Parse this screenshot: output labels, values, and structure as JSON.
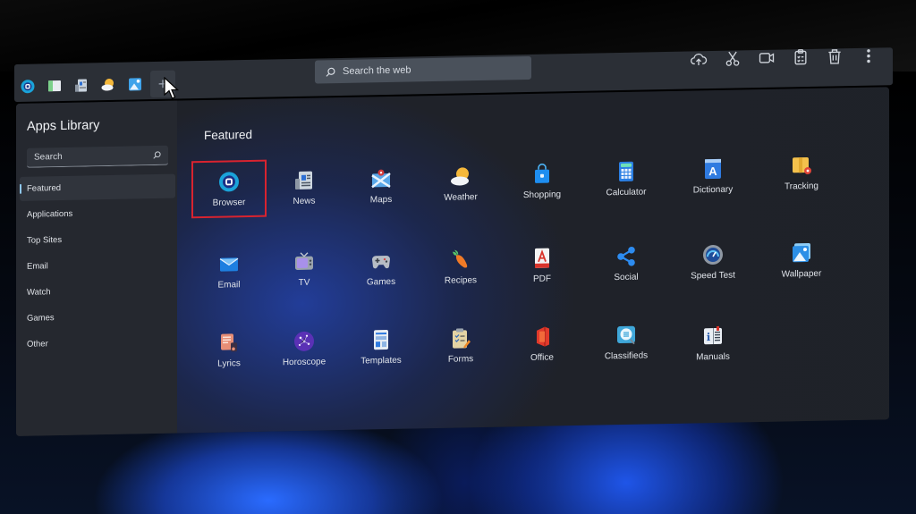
{
  "browser": {
    "tabs": [
      {
        "icon": "browser-logo-icon",
        "color": "#1aa3d9"
      },
      {
        "icon": "sidebar-panel-icon",
        "color": "#7bd08a"
      },
      {
        "icon": "news-icon",
        "color": "#8fb3d9"
      },
      {
        "icon": "weather-icon",
        "color": "#f5b83a"
      },
      {
        "icon": "wallpaper-icon",
        "color": "#3fa3ea"
      }
    ],
    "add_tab_label": "+",
    "search_placeholder": "Search the web",
    "toolbar": [
      {
        "name": "cloud-sync",
        "label": "Cloud sync"
      },
      {
        "name": "cut",
        "label": "Cut"
      },
      {
        "name": "video",
        "label": "Video"
      },
      {
        "name": "clipboard",
        "label": "Clipboard"
      },
      {
        "name": "delete",
        "label": "Delete"
      },
      {
        "name": "more",
        "label": "More options"
      }
    ]
  },
  "sidebar": {
    "title": "Apps Library",
    "search_placeholder": "Search",
    "items": [
      {
        "label": "Featured",
        "active": true
      },
      {
        "label": "Applications"
      },
      {
        "label": "Top Sites"
      },
      {
        "label": "Email"
      },
      {
        "label": "Watch"
      },
      {
        "label": "Games"
      },
      {
        "label": "Other"
      }
    ]
  },
  "main": {
    "section_title": "Featured",
    "selected_app": "Browser",
    "apps": [
      {
        "label": "Browser",
        "icon": "browser-icon"
      },
      {
        "label": "News",
        "icon": "news-icon"
      },
      {
        "label": "Maps",
        "icon": "maps-icon"
      },
      {
        "label": "Weather",
        "icon": "weather-icon"
      },
      {
        "label": "Shopping",
        "icon": "shopping-bag-icon"
      },
      {
        "label": "Calculator",
        "icon": "calculator-icon"
      },
      {
        "label": "Dictionary",
        "icon": "dictionary-icon"
      },
      {
        "label": "Tracking",
        "icon": "package-tracking-icon"
      },
      {
        "label": "Email",
        "icon": "email-icon"
      },
      {
        "label": "TV",
        "icon": "tv-icon"
      },
      {
        "label": "Games",
        "icon": "gamepad-icon"
      },
      {
        "label": "Recipes",
        "icon": "carrot-icon"
      },
      {
        "label": "PDF",
        "icon": "pdf-icon"
      },
      {
        "label": "Social",
        "icon": "share-icon"
      },
      {
        "label": "Speed Test",
        "icon": "speedometer-icon"
      },
      {
        "label": "Wallpaper",
        "icon": "wallpaper-icon"
      },
      {
        "label": "Lyrics",
        "icon": "lyrics-icon"
      },
      {
        "label": "Horoscope",
        "icon": "stars-icon"
      },
      {
        "label": "Templates",
        "icon": "templates-icon"
      },
      {
        "label": "Forms",
        "icon": "forms-icon"
      },
      {
        "label": "Office",
        "icon": "office-icon"
      },
      {
        "label": "Classifieds",
        "icon": "classifieds-icon"
      },
      {
        "label": "Manuals",
        "icon": "manuals-icon"
      }
    ]
  }
}
